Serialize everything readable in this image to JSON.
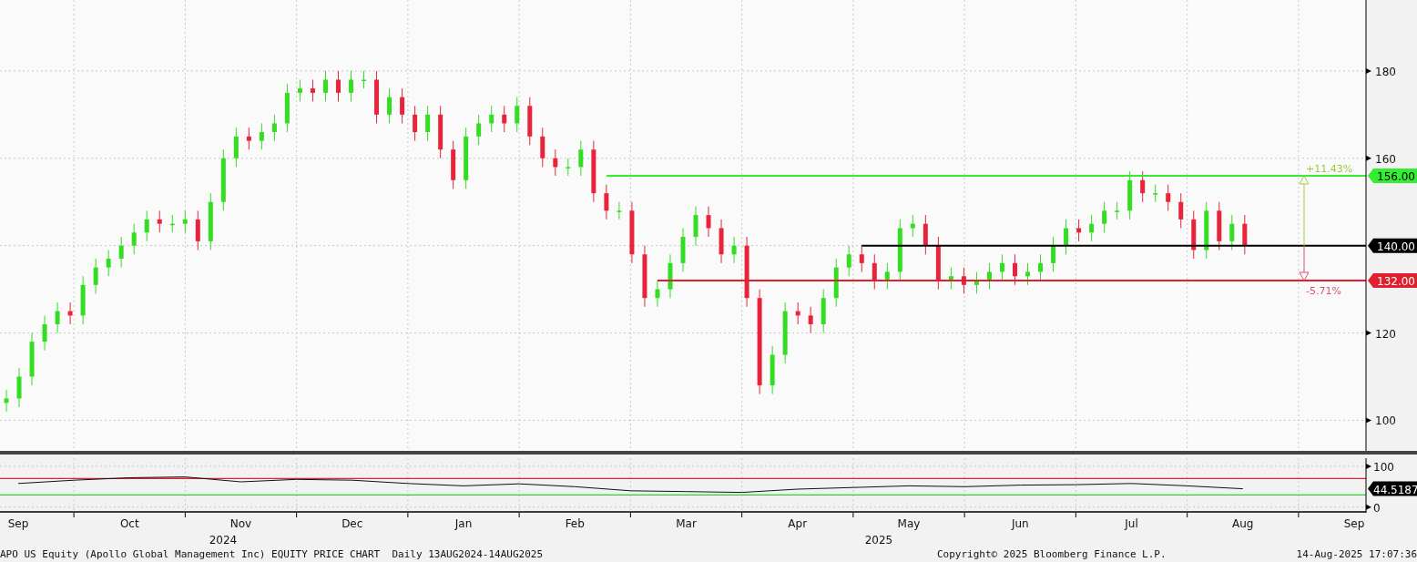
{
  "price_chart": {
    "chart_data": {
      "type": "candlestick",
      "grid": true,
      "ylim": [
        93,
        196.25
      ],
      "yticks": [
        {
          "value": 100,
          "label": "100"
        },
        {
          "value": 120,
          "label": "120"
        },
        {
          "value": 160,
          "label": "160"
        },
        {
          "value": 180,
          "label": "180"
        }
      ],
      "categories": [
        null,
        null,
        null,
        null,
        null,
        null,
        null,
        null,
        null,
        null,
        null,
        null,
        null,
        null,
        null,
        null,
        null,
        null,
        null,
        null,
        null,
        null,
        null,
        null,
        null,
        null,
        null,
        null,
        null,
        null,
        null,
        null,
        null,
        null,
        null,
        null,
        null,
        null,
        null,
        null,
        null,
        null,
        null,
        null,
        null,
        null,
        null,
        null,
        null,
        null,
        null,
        null,
        null,
        null,
        null,
        null,
        null,
        null,
        null,
        null,
        null,
        null,
        null,
        null,
        null,
        null,
        null,
        null,
        null,
        null,
        null,
        null,
        null,
        null,
        null,
        null,
        null,
        null,
        null,
        null,
        null,
        null,
        null,
        null,
        null,
        null,
        null,
        null,
        null,
        null,
        null,
        null,
        null,
        null,
        null,
        null,
        null,
        null,
        null,
        null,
        null,
        null,
        null,
        null,
        null,
        null,
        null
      ],
      "ohlc": [
        [
          104,
          107,
          102,
          105
        ],
        [
          105,
          112,
          103,
          110
        ],
        [
          110,
          120,
          108,
          118
        ],
        [
          118,
          124,
          116,
          122
        ],
        [
          122,
          127,
          120,
          125
        ],
        [
          125,
          127,
          122,
          124
        ],
        [
          124,
          133,
          122,
          131
        ],
        [
          131,
          137,
          129,
          135
        ],
        [
          135,
          139,
          133,
          137
        ],
        [
          137,
          142,
          135,
          140
        ],
        [
          140,
          145,
          138,
          143
        ],
        [
          143,
          148,
          141,
          146
        ],
        [
          146,
          148,
          143,
          145
        ],
        [
          145,
          147,
          143,
          145
        ],
        [
          145,
          148,
          143,
          146
        ],
        [
          146,
          148,
          139,
          141
        ],
        [
          141,
          152,
          139,
          150
        ],
        [
          150,
          162,
          148,
          160
        ],
        [
          160,
          167,
          158,
          165
        ],
        [
          165,
          167,
          162,
          164
        ],
        [
          164,
          168,
          162,
          166
        ],
        [
          166,
          170,
          164,
          168
        ],
        [
          168,
          177,
          166,
          175
        ],
        [
          175,
          178,
          173,
          176
        ],
        [
          176,
          178,
          173,
          175
        ],
        [
          175,
          180,
          173,
          178
        ],
        [
          178,
          180,
          173,
          175
        ],
        [
          175,
          180,
          173,
          178
        ],
        [
          178,
          180,
          176,
          178
        ],
        [
          178,
          180,
          168,
          170
        ],
        [
          170,
          176,
          168,
          174
        ],
        [
          174,
          176,
          168,
          170
        ],
        [
          170,
          172,
          164,
          166
        ],
        [
          166,
          172,
          164,
          170
        ],
        [
          170,
          172,
          160,
          162
        ],
        [
          162,
          164,
          153,
          155
        ],
        [
          155,
          167,
          153,
          165
        ],
        [
          165,
          170,
          163,
          168
        ],
        [
          168,
          172,
          166,
          170
        ],
        [
          170,
          172,
          166,
          168
        ],
        [
          168,
          174,
          166,
          172
        ],
        [
          172,
          174,
          163,
          165
        ],
        [
          165,
          167,
          158,
          160
        ],
        [
          160,
          162,
          156,
          158
        ],
        [
          158,
          160,
          156,
          158
        ],
        [
          158,
          164,
          156,
          162
        ],
        [
          162,
          164,
          150,
          152
        ],
        [
          152,
          154,
          146,
          148
        ],
        [
          148,
          150,
          146,
          148
        ],
        [
          148,
          150,
          136,
          138
        ],
        [
          138,
          140,
          126,
          128
        ],
        [
          128,
          132,
          126,
          130
        ],
        [
          130,
          138,
          128,
          136
        ],
        [
          136,
          144,
          134,
          142
        ],
        [
          142,
          149,
          140,
          147
        ],
        [
          147,
          149,
          142,
          144
        ],
        [
          144,
          146,
          136,
          138
        ],
        [
          138,
          142,
          136,
          140
        ],
        [
          140,
          142,
          126,
          128
        ],
        [
          128,
          130,
          106,
          108
        ],
        [
          108,
          117,
          106,
          115
        ],
        [
          115,
          127,
          113,
          125
        ],
        [
          125,
          127,
          122,
          124
        ],
        [
          124,
          126,
          120,
          122
        ],
        [
          122,
          130,
          120,
          128
        ],
        [
          128,
          137,
          126,
          135
        ],
        [
          135,
          140,
          133,
          138
        ],
        [
          138,
          140,
          134,
          136
        ],
        [
          136,
          138,
          130,
          132
        ],
        [
          132,
          136,
          130,
          134
        ],
        [
          134,
          146,
          132,
          144
        ],
        [
          144,
          147,
          142,
          145
        ],
        [
          145,
          147,
          138,
          140
        ],
        [
          140,
          142,
          130,
          132
        ],
        [
          132,
          135,
          130,
          133
        ],
        [
          133,
          135,
          129,
          131
        ],
        [
          131,
          134,
          129,
          132
        ],
        [
          132,
          136,
          130,
          134
        ],
        [
          134,
          138,
          132,
          136
        ],
        [
          136,
          138,
          131,
          133
        ],
        [
          133,
          136,
          131,
          134
        ],
        [
          134,
          138,
          132,
          136
        ],
        [
          136,
          142,
          134,
          140
        ],
        [
          140,
          146,
          138,
          144
        ],
        [
          144,
          146,
          141,
          143
        ],
        [
          143,
          147,
          141,
          145
        ],
        [
          145,
          150,
          143,
          148
        ],
        [
          148,
          150,
          146,
          148
        ],
        [
          148,
          157,
          146,
          155
        ],
        [
          155,
          157,
          150,
          152
        ],
        [
          152,
          154,
          150,
          152
        ],
        [
          152,
          154,
          148,
          150
        ],
        [
          150,
          152,
          144,
          146
        ],
        [
          146,
          148,
          137,
          139
        ],
        [
          139,
          150,
          137,
          148
        ],
        [
          148,
          150,
          139,
          141
        ],
        [
          141,
          147,
          139,
          145
        ],
        [
          145,
          147,
          138,
          140
        ],
        null,
        null,
        null,
        null,
        null,
        null,
        null,
        null,
        null
      ],
      "ref_lines": [
        {
          "axis": "y",
          "value": 156,
          "label": "156.00",
          "color": "#33ee33"
        },
        {
          "axis": "y",
          "value": 140,
          "label": "140.00",
          "color": "#000000"
        },
        {
          "axis": "y",
          "value": 132,
          "label": "132.00",
          "color": "#e0202e"
        }
      ],
      "annotations": [
        "+11.43%",
        "-5.71%"
      ]
    }
  },
  "rsi_chart": {
    "chart_data": {
      "type": "line",
      "grid": true,
      "ylim": [
        -14,
        120
      ],
      "yticks": [
        {
          "value": 0,
          "label": "0"
        },
        {
          "value": 100,
          "label": "100"
        }
      ],
      "categories": [
        "Sep",
        null,
        "Oct",
        null,
        "Nov",
        null,
        "Dec",
        null,
        "Jan",
        null,
        "Feb",
        null,
        "Mar",
        null,
        "Apr",
        null,
        "May",
        null,
        "Jun",
        null,
        "Jul",
        null,
        "Aug",
        null,
        "Sep"
      ],
      "series": [
        {
          "color": "#111111",
          "values": [
            58,
            66,
            72,
            74,
            62,
            68,
            66,
            58,
            52,
            57,
            50,
            40,
            38,
            36,
            44,
            48,
            52,
            50,
            54,
            55,
            58,
            52,
            45,
            null,
            null
          ]
        }
      ],
      "ref_lines": [
        {
          "axis": "y",
          "value": 70,
          "color": "#d42a2a"
        },
        {
          "axis": "y",
          "value": 30,
          "color": "#33cc33"
        }
      ],
      "annotations": [
        "44.5187"
      ]
    }
  },
  "years": [
    "2024",
    "2025"
  ],
  "footer": {
    "description": "APO US Equity (Apollo Global Management Inc) EQUITY PRICE CHART  Daily 13AUG2024-14AUG2025",
    "copyright": "Copyright© 2025 Bloomberg Finance L.P.",
    "timestamp": "14-Aug-2025 17:07:36"
  }
}
